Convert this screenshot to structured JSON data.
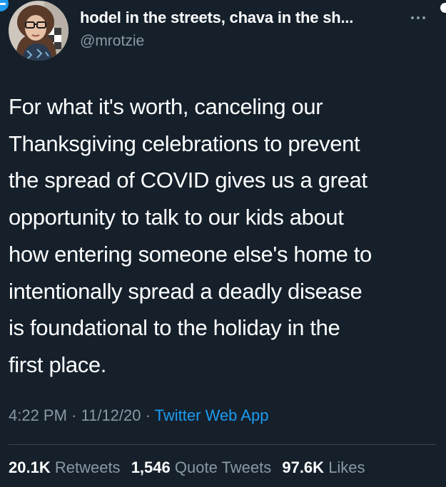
{
  "tweet": {
    "author": {
      "display_name": "hodel in the streets, chava in the sh...",
      "handle": "@mrotzie"
    },
    "body_lines": [
      "For what it's worth, canceling our",
      "Thanksgiving celebrations to prevent",
      "the spread of COVID gives us a great",
      "opportunity to talk to our kids about",
      "how entering someone else's home to",
      "intentionally spread a deadly disease",
      "is foundational to the holiday in the",
      "first place."
    ],
    "time": "4:22 PM",
    "separator": " · ",
    "date": "11/12/20",
    "source": "Twitter Web App",
    "stats": {
      "retweets": {
        "count": "20.1K",
        "label": "Retweets"
      },
      "quote_tweets": {
        "count": "1,546",
        "label": "Quote Tweets"
      },
      "likes": {
        "count": "97.6K",
        "label": "Likes"
      }
    }
  },
  "colors": {
    "background": "#15202b",
    "text_primary": "#ffffff",
    "text_secondary": "#8b98a5",
    "accent": "#1d9bf0",
    "divider": "#38444d"
  },
  "icons": {
    "more_menu": "more-horizontal-icon"
  }
}
